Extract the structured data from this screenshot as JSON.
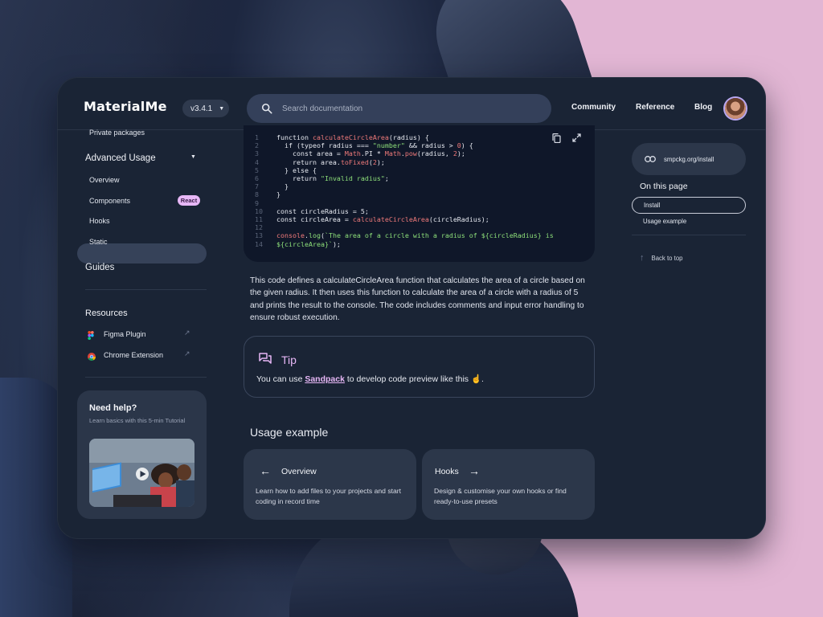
{
  "app": {
    "logo": "MaterialMe",
    "version": "v3.4.1"
  },
  "header": {
    "search_placeholder": "Search documentation",
    "nav": [
      "Community",
      "Reference",
      "Blog"
    ]
  },
  "sidebar": {
    "top_item": "Private packages",
    "advanced_section": "Advanced Usage",
    "items": [
      {
        "label": "Overview"
      },
      {
        "label": "Components",
        "badge": "React",
        "active": true
      },
      {
        "label": "Hooks"
      },
      {
        "label": "Static"
      }
    ],
    "guides": "Guides",
    "resources_title": "Resources",
    "resources": [
      {
        "label": "Figma Plugin",
        "icon": "figma-icon"
      },
      {
        "label": "Chrome Extension",
        "icon": "chrome-icon"
      }
    ],
    "help": {
      "title": "Need help?",
      "subtitle": "Learn basics with this 5-min Tutorial"
    }
  },
  "code": {
    "lines": [
      {
        "n": "1",
        "text": "function calculateCircleArea(radius) {"
      },
      {
        "n": "2",
        "text": "  if (typeof radius === \"number\" && radius > 0) {"
      },
      {
        "n": "3",
        "text": "    const area = Math.PI * Math.pow(radius, 2);"
      },
      {
        "n": "4",
        "text": "    return area.toFixed(2);"
      },
      {
        "n": "5",
        "text": "  } else {"
      },
      {
        "n": "6",
        "text": "    return \"Invalid radius\";"
      },
      {
        "n": "7",
        "text": "  }"
      },
      {
        "n": "8",
        "text": "}"
      },
      {
        "n": "9",
        "text": ""
      },
      {
        "n": "10",
        "text": "const circleRadius = 5;"
      },
      {
        "n": "11",
        "text": "const circleArea = calculateCircleArea(circleRadius);"
      },
      {
        "n": "12",
        "text": ""
      },
      {
        "n": "13",
        "text": "console.log(`The area of a circle with a radius of ${circleRadius} is"
      },
      {
        "n": "14",
        "text": "${circleArea}`);"
      }
    ]
  },
  "content": {
    "paragraph": "This code defines a calculateCircleArea function that calculates the area of a circle based on the given radius. It then uses this function to calculate the area of a circle with a radius of 5 and prints the result to the console. The code includes comments and input error handling to ensure robust execution.",
    "tip": {
      "title": "Tip",
      "prefix": "You can use ",
      "link": "Sandpack",
      "suffix": " to develop code preview like this ☝️."
    },
    "usage_title": "Usage example",
    "cards": [
      {
        "title": "Overview",
        "description": "Learn how to add files to your projects and start coding in record time"
      },
      {
        "title": "Hooks",
        "description": "Design & customise your own hooks or find ready-to-use presets"
      }
    ]
  },
  "right": {
    "package_link": "smpckg.org/install",
    "on_this_page": "On this page",
    "toc": [
      {
        "label": "Install",
        "active": true
      },
      {
        "label": "Usage example"
      }
    ],
    "back_to_top": "Back to top"
  },
  "colors": {
    "accent": "#e7b7f6",
    "window_bg": "#1a2435",
    "code_bg": "#0f1729",
    "card_bg": "#2c374a",
    "page_bg": "#e2b6d4"
  }
}
